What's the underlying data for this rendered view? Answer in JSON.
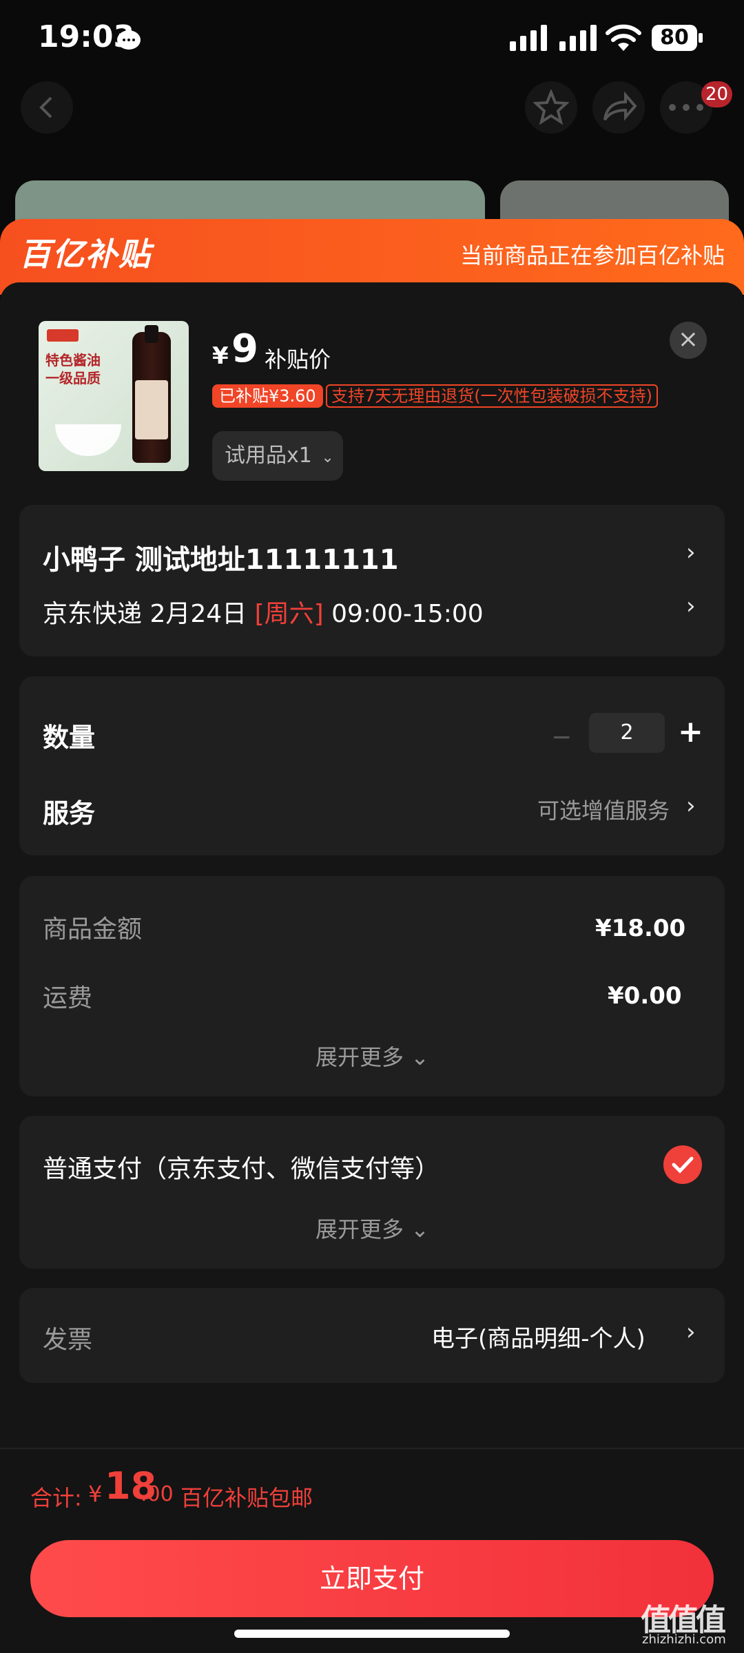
{
  "status_bar": {
    "time": "19:03",
    "battery": "80"
  },
  "nav": {
    "notification_count": "20"
  },
  "banner": {
    "title": "百亿补贴",
    "note": "当前商品正在参加百亿补贴"
  },
  "product": {
    "currency": "¥",
    "price": "9",
    "price_label": "补贴价",
    "subsidy_tag": "已补贴¥3.60",
    "return_policy": "支持7天无理由退货(一次性包装破损不支持)",
    "variant": "试用品x1",
    "image_text": "特色酱油\n一级品质"
  },
  "address": {
    "name_line": "小鸭子  测试地址11111111",
    "delivery_prefix": "京东快递 2月24日 ",
    "delivery_day": "[周六]",
    "delivery_time": " 09:00-15:00"
  },
  "options": {
    "quantity_label": "数量",
    "quantity_minus": "−",
    "quantity_value": "2",
    "quantity_plus": "+",
    "service_label": "服务",
    "service_value": "可选增值服务"
  },
  "amounts": {
    "goods_label": "商品金额",
    "goods_value": "¥18.00",
    "shipping_label": "运费",
    "shipping_value": "¥0.00",
    "expand": "展开更多 ⌄"
  },
  "payment": {
    "method": "普通支付（京东支付、微信支付等）",
    "expand": "展开更多 ⌄"
  },
  "invoice": {
    "label": "发票",
    "value": "电子(商品明细-个人)"
  },
  "footer": {
    "total_label": "合计:",
    "currency": "¥",
    "total_int": "18",
    "total_dec": ".00",
    "total_note": "百亿补贴包邮",
    "pay_button": "立即支付"
  },
  "watermark": {
    "text": "值值值",
    "sub": "zhizhizhi.com"
  },
  "colors": {
    "accent": "#f0403a",
    "banner": "#f6501f",
    "card": "#1f1f1f",
    "sheet": "#151515"
  },
  "icons": [
    "back-icon",
    "star-icon",
    "share-icon",
    "more-icon",
    "close-icon",
    "chevron-right-icon",
    "check-icon"
  ]
}
